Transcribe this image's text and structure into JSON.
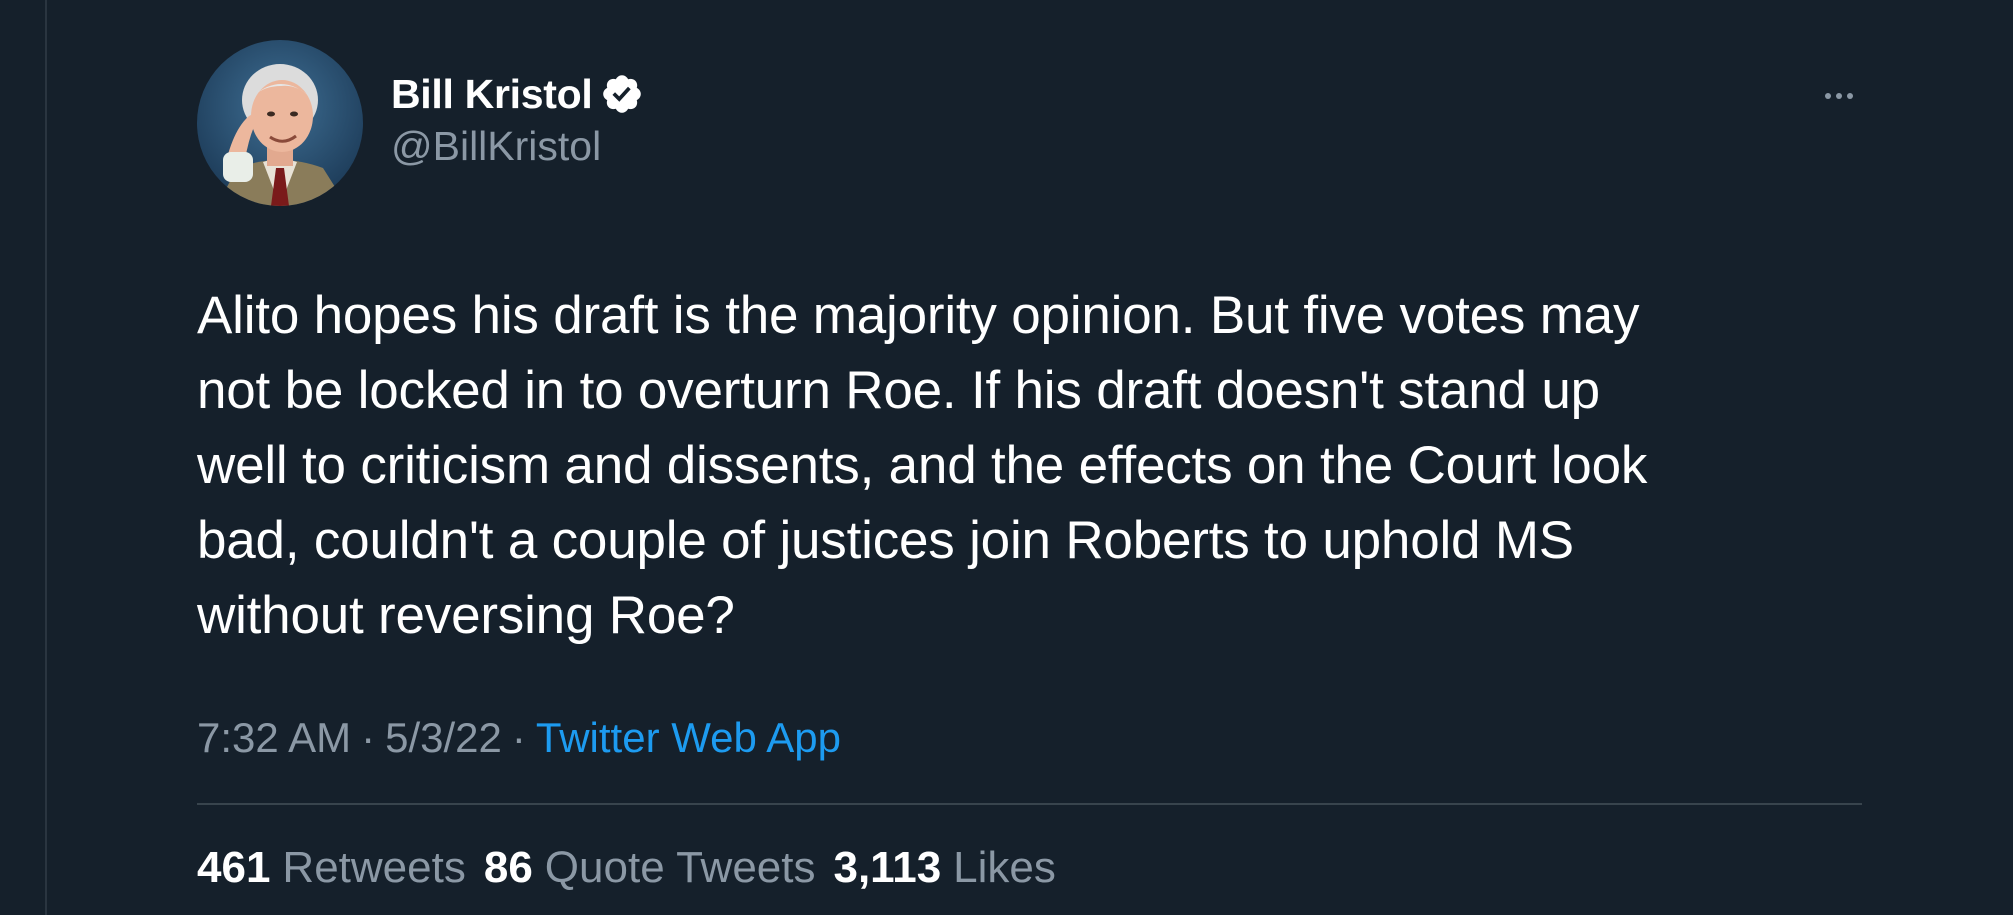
{
  "tweet": {
    "author": {
      "display_name": "Bill Kristol",
      "handle": "@BillKristol",
      "verified": true,
      "avatar_icon": "profile-photo"
    },
    "more_icon": "more-horizontal-icon",
    "text": "Alito hopes his draft is the majority opinion. But five votes may\nnot be locked in to overturn Roe. If his draft doesn't stand up\nwell to criticism and dissents, and the effects on the Court look\nbad, couldn't a couple of justices join Roberts to uphold MS\nwithout reversing Roe?",
    "time": "7:32 AM",
    "separator": "·",
    "date": "5/3/22",
    "source": "Twitter Web App",
    "stats": {
      "retweets": {
        "count": "461",
        "label": "Retweets"
      },
      "quote_tweets": {
        "count": "86",
        "label": "Quote Tweets"
      },
      "likes": {
        "count": "3,113",
        "label": "Likes"
      }
    }
  },
  "colors": {
    "background": "#15202b",
    "text_primary": "#ffffff",
    "text_secondary": "#8b98a5",
    "link": "#1d9bf0",
    "divider": "#38444d"
  }
}
